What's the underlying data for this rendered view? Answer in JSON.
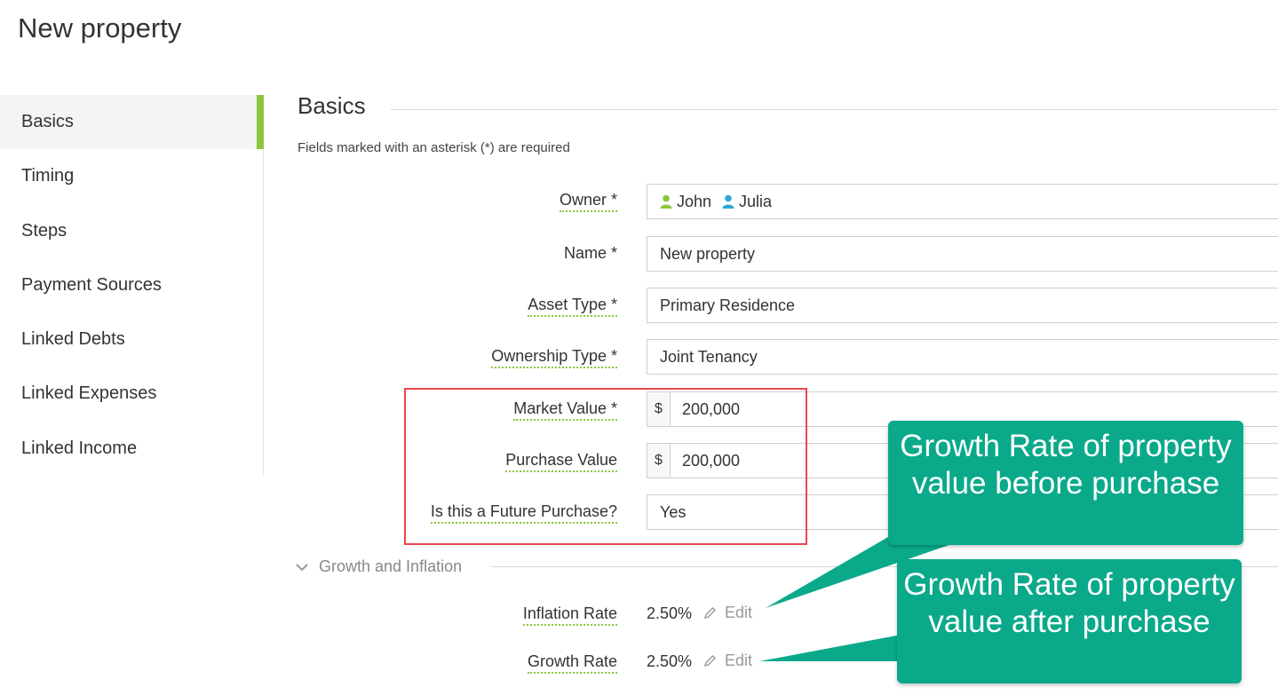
{
  "page": {
    "title": "New property"
  },
  "sidebar": {
    "items": [
      {
        "label": "Basics",
        "active": true
      },
      {
        "label": "Timing"
      },
      {
        "label": "Steps"
      },
      {
        "label": "Payment Sources"
      },
      {
        "label": "Linked Debts"
      },
      {
        "label": "Linked Expenses"
      },
      {
        "label": "Linked Income"
      }
    ]
  },
  "section": {
    "title": "Basics",
    "required_note": "Fields marked with an asterisk (*) are required"
  },
  "form": {
    "owner": {
      "label": "Owner *",
      "owners": [
        {
          "name": "John",
          "color": "#8cc63f"
        },
        {
          "name": "Julia",
          "color": "#29a8d8"
        }
      ]
    },
    "name": {
      "label": "Name *",
      "value": "New property"
    },
    "asset_type": {
      "label": "Asset Type *",
      "value": "Primary Residence"
    },
    "ownership_type": {
      "label": "Ownership Type *",
      "value": "Joint Tenancy"
    },
    "market_value": {
      "label": "Market Value *",
      "currency": "$",
      "value": "200,000"
    },
    "purchase_value": {
      "label": "Purchase Value",
      "currency": "$",
      "value": "200,000"
    },
    "future_purchase": {
      "label": "Is this a Future Purchase?",
      "value": "Yes"
    }
  },
  "growth": {
    "title": "Growth and Inflation",
    "inflation": {
      "label": "Inflation Rate",
      "value": "2.50%",
      "edit_label": "Edit"
    },
    "growth_rate": {
      "label": "Growth Rate",
      "value": "2.50%",
      "edit_label": "Edit"
    }
  },
  "callouts": {
    "before": "Growth Rate of property value before purchase",
    "after": "Growth Rate of property value after purchase"
  },
  "colors": {
    "accent": "#8cc63f",
    "callout": "#0aa98a",
    "highlight": "#e8474f"
  }
}
